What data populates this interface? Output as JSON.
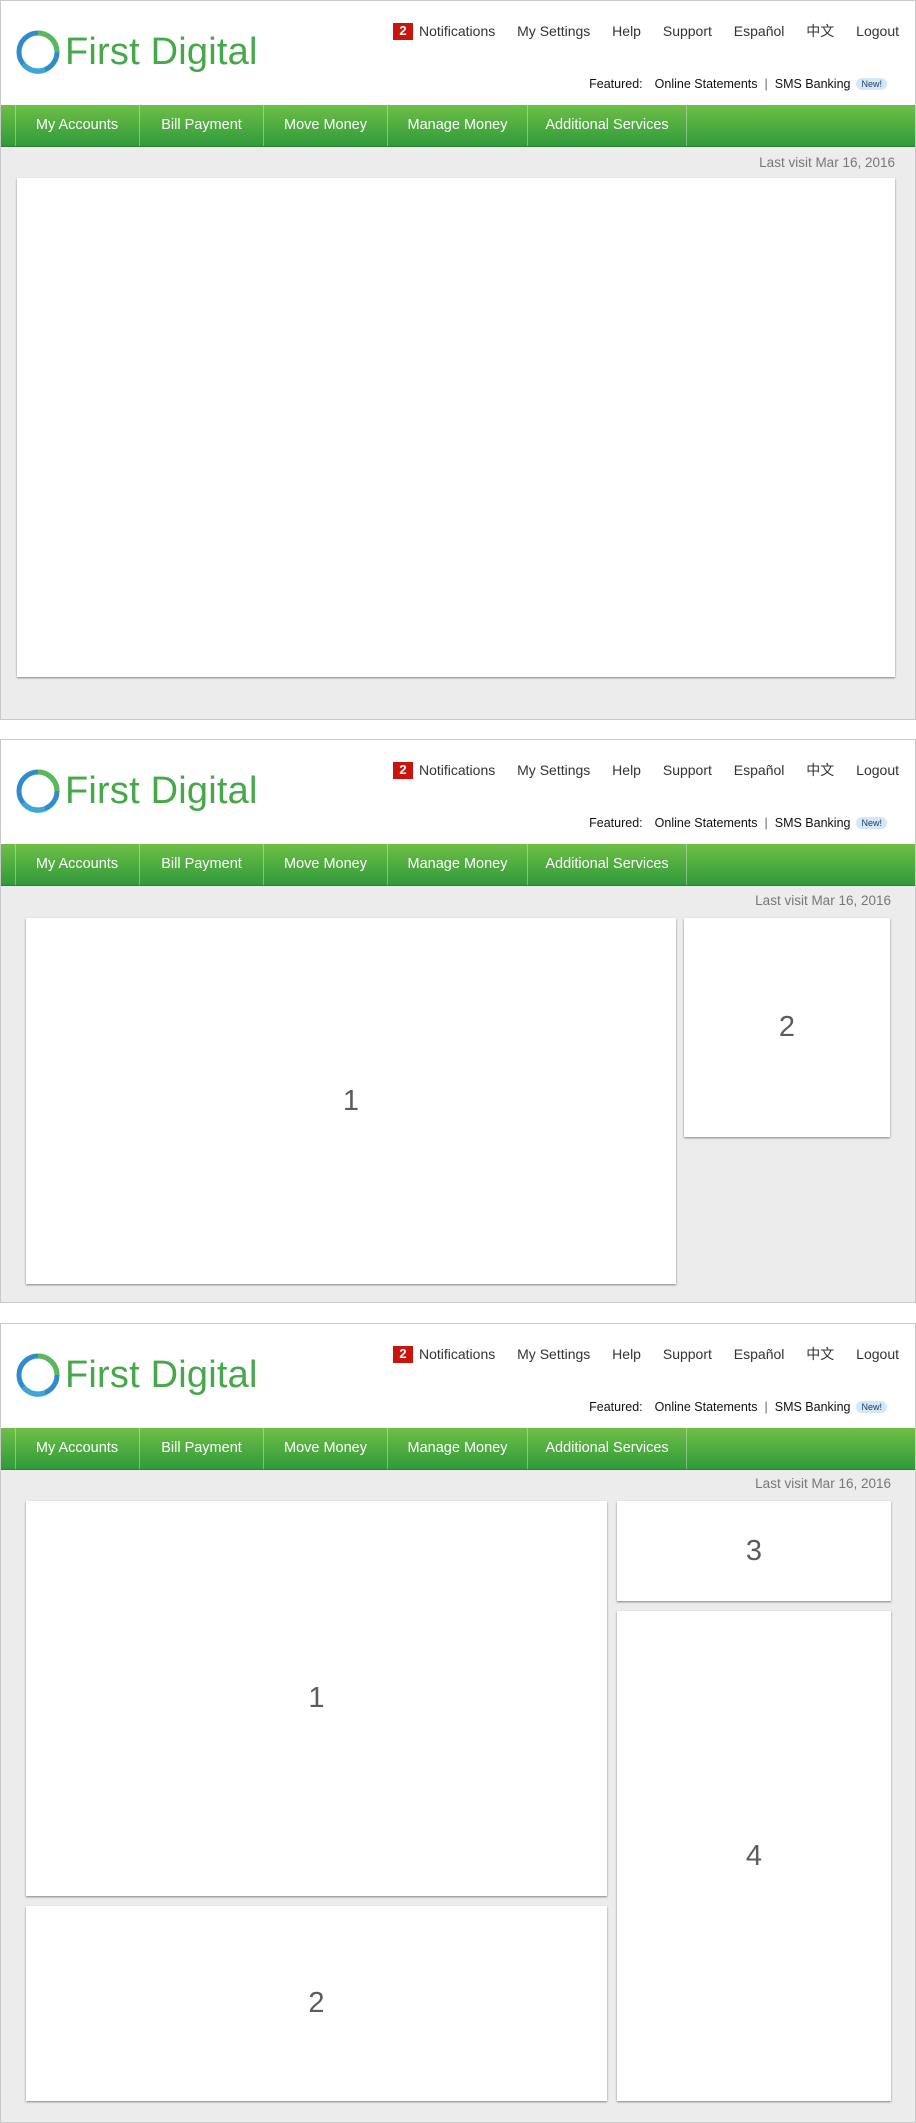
{
  "header": {
    "brand": "First Digital",
    "notifications_count": "2",
    "notifications_label": "Notifications",
    "links": {
      "settings": "My Settings",
      "help": "Help",
      "support": "Support",
      "spanish": "Español",
      "chinese": "中文",
      "logout": "Logout"
    },
    "featured": {
      "label": "Featured:",
      "online_statements": "Online Statements",
      "separator": "|",
      "sms_banking": "SMS Banking",
      "new_tag": "New!"
    }
  },
  "nav": {
    "my_accounts": "My Accounts",
    "bill_payment": "Bill Payment",
    "move_money": "Move Money",
    "manage_money": "Manage Money",
    "additional_services": "Additional Services"
  },
  "last_visit": "Last visit Mar 16, 2016",
  "layouts": {
    "layout_two_panels": {
      "panel_1": "1",
      "panel_2": "2"
    },
    "layout_four_panels": {
      "panel_1": "1",
      "panel_2": "2",
      "panel_3": "3",
      "panel_4": "4"
    }
  },
  "colors": {
    "nav_gradient_top": "#6fbf46",
    "nav_gradient_bottom": "#2f9a3b",
    "notification_badge": "#c8160f",
    "brand_text": "#46a84a",
    "page_background": "#ececec"
  }
}
